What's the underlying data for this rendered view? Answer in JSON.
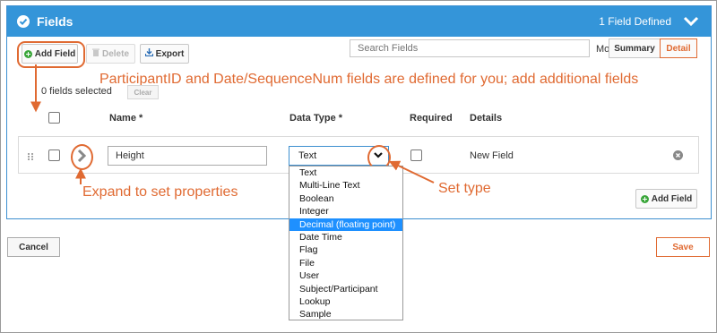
{
  "panel": {
    "title": "Fields",
    "count": "1 Field Defined"
  },
  "toolbar": {
    "add_field": "Add Field",
    "delete": "Delete",
    "export": "Export",
    "search_placeholder": "Search Fields",
    "mode_label": "Mode:",
    "mode_summary": "Summary",
    "mode_detail": "Detail"
  },
  "selection": {
    "count_text": "0 fields selected",
    "clear": "Clear"
  },
  "columns": {
    "name": "Name *",
    "data_type": "Data Type *",
    "required": "Required",
    "details": "Details"
  },
  "field_row": {
    "name_value": "Height",
    "data_type_value": "Text",
    "details": "New Field"
  },
  "data_type_options": [
    "Text",
    "Multi-Line Text",
    "Boolean",
    "Integer",
    "Decimal (floating point)",
    "Date Time",
    "Flag",
    "File",
    "User",
    "Subject/Participant",
    "Lookup",
    "Sample"
  ],
  "highlighted_option": "Decimal (floating point)",
  "bottom_add_field": "Add Field",
  "footer": {
    "cancel": "Cancel",
    "save": "Save"
  },
  "annotations": {
    "top_note": "ParticipantID and Date/SequenceNum fields are defined for you; add additional fields",
    "expand_note": "Expand to set properties",
    "type_note": "Set type"
  },
  "colors": {
    "header_blue": "#3495d9",
    "annotation_orange": "#e06a32",
    "selection_blue": "#1e90ff",
    "add_green": "#3aa63a"
  }
}
